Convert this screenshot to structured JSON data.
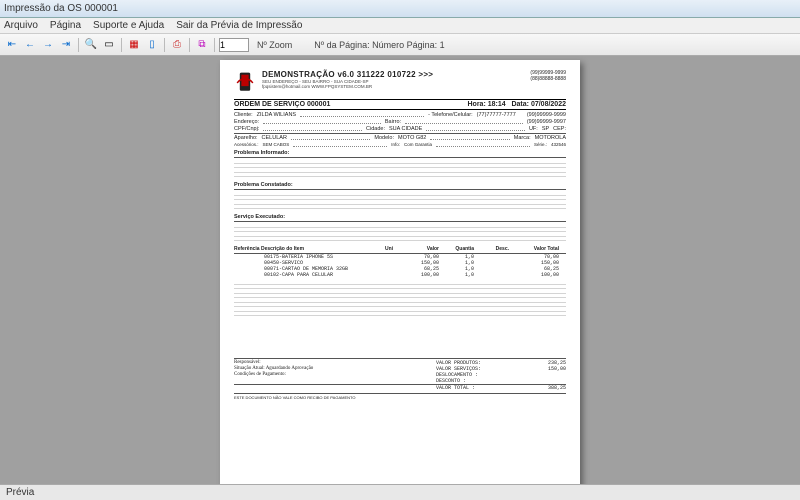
{
  "window": {
    "title": "Impressão da OS 000001"
  },
  "menu": {
    "arquivo": "Arquivo",
    "pagina": "Página",
    "suporte": "Suporte e Ajuda",
    "sair": "Sair da Prévia de Impressão"
  },
  "toolbar": {
    "zoom_lbl": "Nº Zoom",
    "zoom_val": "1",
    "page_lbl": "Nº da Página: Número Página: 1"
  },
  "doc": {
    "company": "DEMONSTRAÇÃO v6.0 311222 010722 >>>",
    "addr": "SEU ENDEREÇO - SEU BAIRRO - SUA CIDADE-SP",
    "email": "fpqsistem@hotmail.com WWW.FPQSYSTEM.COM.BR",
    "phone1": "(99)99999-9999",
    "phone2": "(88)88888-8888",
    "order_title": "ORDEM DE SERVIÇO 000001",
    "hora_lbl": "Hora:",
    "hora": "18:14",
    "data_lbl": "Data:",
    "data": "07/08/2022",
    "cliente_lbl": "Cliente:",
    "cliente": "ZILDA WILIANS",
    "tel_lbl": "- Telefone/Celular:",
    "tel": "(77)77777-7777",
    "tel2": "(99)99999-9999",
    "end_lbl": "Endereço:",
    "bairro_lbl": "Bairro:",
    "bairro_ph": "(99)99999-9997",
    "cpf_lbl": "CPF/Cnpj:",
    "cidade_lbl": "Cidade:",
    "cidade": "SUA CIDADE",
    "uf_lbl": "UF:",
    "uf": "SP",
    "cep_lbl": "CEP:",
    "aparelho_lbl": "Aparelho:",
    "aparelho": "CELULAR",
    "modelo_lbl": "Modelo:",
    "modelo": "MOTO G82",
    "marca_lbl": "Marca:",
    "marca": "MOTOROLA",
    "acess_lbl": "Acessórios.:",
    "acess": "SEM CABOS",
    "info_lbl": "Info:",
    "info": "Com Garantia",
    "serie_lbl": "Série.:",
    "serie": "432546",
    "prob_inf": "Problema Informado:",
    "prob_con": "Problema Constatado:",
    "serv_exe": "Serviço Executado:",
    "tbl": {
      "h1": "Referência  Descrição do Item",
      "h2": "Uni",
      "h3": "Valor",
      "h4": "Quantia",
      "h5": "Desc.",
      "h6": "Valor Total"
    },
    "items": [
      {
        "d": "00175-BATERIA IPHONE 5S",
        "v": "70,00",
        "q": "1,0",
        "t": "70,00"
      },
      {
        "d": "00450-SERVICO",
        "v": "150,00",
        "q": "1,0",
        "t": "150,00"
      },
      {
        "d": "00071-CARTAO DE MEMORIA 32GB",
        "v": "68,25",
        "q": "1,0",
        "t": "68,25"
      },
      {
        "d": "00102-CAPA PARA CELULAR",
        "v": "100,00",
        "q": "1,0",
        "t": "100,00"
      }
    ],
    "resp_lbl": "Responsável:",
    "sit_lbl": "Situação Atual:",
    "sit": "Aguardando Aprovação",
    "cond_lbl": "Condições de Pagamento:",
    "tot_prod_lbl": "VALOR PRODUTOS:",
    "tot_prod": "238,25",
    "tot_serv_lbl": "VALOR SERVIÇOS:",
    "tot_serv": "150,00",
    "tot_desl_lbl": "DESLOCAMENTO :",
    "tot_desc_lbl": "DESCONTO     :",
    "tot_total_lbl": "VALOR TOTAL  :",
    "tot_total": "388,25",
    "footnote": "ESTE DOCUMENTO NÃO VALE COMO RECIBO DE PAGAMENTO"
  },
  "status": {
    "previa": "Prévia"
  }
}
